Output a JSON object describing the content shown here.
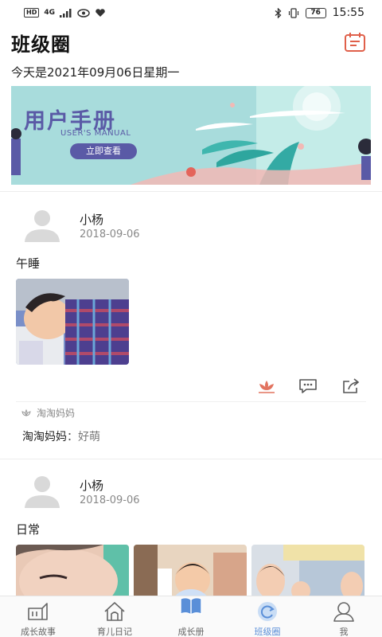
{
  "status_bar": {
    "left_pill": "HD",
    "network": "4G",
    "time": "15:55",
    "battery": "76"
  },
  "header": {
    "title": "班级圈",
    "date_text": "今天是2021年09月06日星期一",
    "calendar_icon": "calendar-icon"
  },
  "banner": {
    "title": "用户手册",
    "subtitle": "USER'S MANUAL",
    "button": "立即查看"
  },
  "posts": [
    {
      "author": "小杨",
      "date": "2018-09-06",
      "text": "午睡",
      "liked_by": "淘淘妈妈",
      "comment_user": "淘淘妈妈",
      "comment_sep": "：",
      "comment_text": "好萌"
    },
    {
      "author": "小杨",
      "date": "2018-09-06",
      "text": "日常"
    }
  ],
  "tabs": [
    {
      "label": "成长故事",
      "icon": "story-icon"
    },
    {
      "label": "育儿日记",
      "icon": "house-icon"
    },
    {
      "label": "成长册",
      "icon": "book-icon"
    },
    {
      "label": "班级圈",
      "icon": "refresh-icon",
      "active": true
    },
    {
      "label": "我",
      "icon": "user-icon"
    }
  ],
  "colors": {
    "accent": "#5a8fd8",
    "banner_bg": "#a8dcdc",
    "banner_text": "#5a5aa6",
    "calendar": "#e0604a",
    "like": "#e2735f"
  }
}
